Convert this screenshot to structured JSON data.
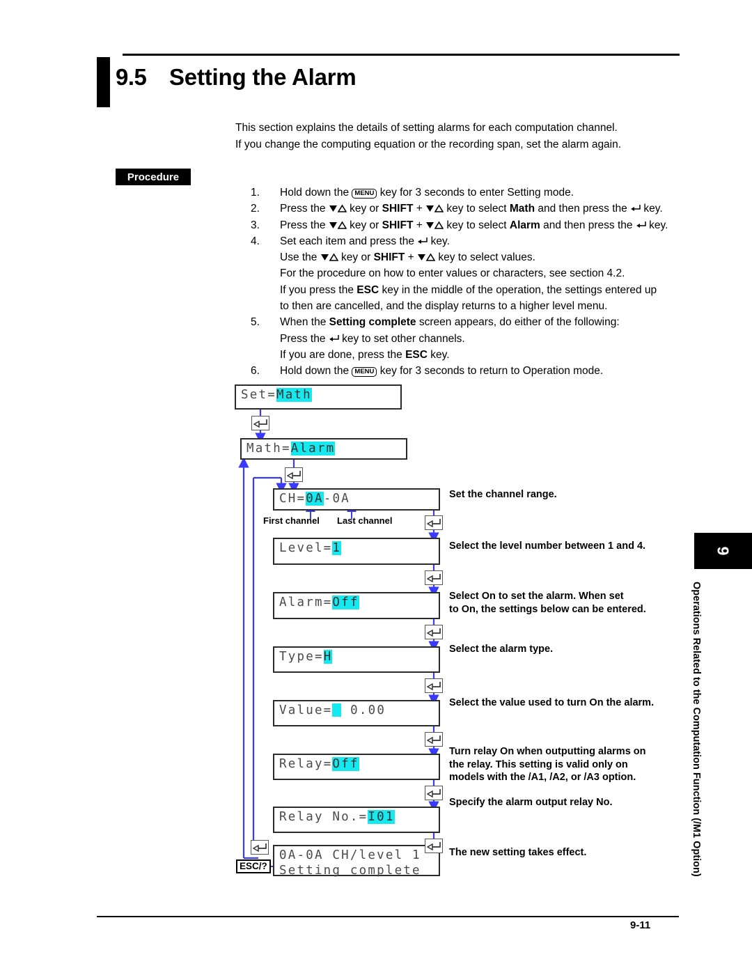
{
  "header": {
    "section_number": "9.5",
    "section_title": "Setting the Alarm"
  },
  "intro": {
    "line1": "This section explains the details of setting alarms for each computation channel.",
    "line2": "If you change the computing equation or the recording span, set the alarm again."
  },
  "procedure": {
    "badge": "Procedure",
    "steps": [
      {
        "num": "1.",
        "text": "Hold down the [MENU] key for 3 seconds to enter Setting mode."
      },
      {
        "num": "2.",
        "text": "Press the ▽△ key or SHIFT + ▽△ key to select Math and then press the ⏎ key."
      },
      {
        "num": "3.",
        "text": "Press the ▽△ key or SHIFT + ▽△ key to select Alarm and then press the ⏎ key."
      },
      {
        "num": "4.",
        "text": "Set each item and press the ⏎ key."
      },
      {
        "num": "",
        "text": "Use the ▽△ key or SHIFT + ▽△ key to select values."
      },
      {
        "num": "",
        "text": "For the procedure on how to enter values or characters, see section 4.2."
      },
      {
        "num": "",
        "text": "If you press the ESC key in the middle of the operation, the settings entered up"
      },
      {
        "num": "",
        "text": "to then are cancelled, and the display returns to a higher level menu."
      },
      {
        "num": "5.",
        "text": "When the Setting complete screen appears, do either of the following:"
      },
      {
        "num": "",
        "text": "Press the ⏎ key to set other channels."
      },
      {
        "num": "",
        "text": "If you are done, press the ESC key."
      },
      {
        "num": "6.",
        "text": "Hold down the [MENU] key for 3 seconds to return to Operation mode."
      }
    ],
    "step1_a": "Hold down the",
    "step1_b": "key for 3 seconds to enter Setting mode.",
    "step2_a": "Press the",
    "step2_b": "key or",
    "step2_shift": "SHIFT",
    "step2_c": "key to select",
    "step2_target": "Math",
    "step2_d": "and then press the",
    "step2_e": "key.",
    "step3_target": "Alarm",
    "step4_a": "Set each item and press the",
    "step4_b": "key.",
    "step4_use_a": "Use the",
    "step4_use_b": "key or",
    "step4_use_c": "key to select values.",
    "step4_sect": "For the procedure on how to enter values or characters, see section 4.2.",
    "step4_esc_a": "If you press the",
    "step4_esc_key": "ESC",
    "step4_esc_b": "key in the middle of the operation, the settings entered up",
    "step4_esc_c": "to then are cancelled, and the display returns to a higher level menu.",
    "step5_a": "When the",
    "step5_bold": "Setting complete",
    "step5_b": "screen appears, do either of the following:",
    "step5_press_a": "Press the",
    "step5_press_b": "key to set other channels.",
    "step5_done_a": "If you are done, press the",
    "step5_done_b": "key.",
    "step6_a": "Hold down the",
    "step6_b": "key for 3 seconds to return to Operation mode."
  },
  "flow": {
    "screens": [
      {
        "id": "set-math",
        "prefix": "Set=",
        "highlight": "Math",
        "suffix": ""
      },
      {
        "id": "math-alarm",
        "prefix": "Math=",
        "highlight": "Alarm",
        "suffix": ""
      },
      {
        "id": "ch-range",
        "prefix": "CH=",
        "highlight": "0A",
        "suffix": "-0A"
      },
      {
        "id": "level",
        "prefix": "Level=",
        "highlight": "1",
        "suffix": ""
      },
      {
        "id": "alarm-onoff",
        "prefix": "Alarm=",
        "highlight": "Off",
        "suffix": ""
      },
      {
        "id": "type",
        "prefix": "Type=",
        "highlight": "H",
        "suffix": ""
      },
      {
        "id": "value",
        "prefix": "Value=",
        "highlight": "",
        "suffix": "    0.00"
      },
      {
        "id": "relay-onoff",
        "prefix": "Relay=",
        "highlight": "Off",
        "suffix": ""
      },
      {
        "id": "relay-no",
        "prefix": "Relay No.=",
        "highlight": "I01",
        "suffix": ""
      }
    ],
    "complete_line1": "0A-0A CH/level 1",
    "complete_line2": "Setting complete",
    "first_channel_label": "First channel",
    "last_channel_label": "Last channel",
    "esc_label": "ESC/?",
    "annotations": {
      "ch_range": "Set the channel range.",
      "level": "Select the level number between 1 and 4.",
      "alarm_l1": "Select On to set the alarm.  When set",
      "alarm_l2": "to On, the settings below can be entered.",
      "type": "Select the alarm type.",
      "value": "Select the value used to turn On the alarm.",
      "relay_l1": "Turn relay On when outputting alarms on",
      "relay_l2": "the relay.  This setting is valid only on",
      "relay_l3": "models with the /A1, /A2, or /A3 option.",
      "relay_no": "Specify the alarm output relay No.",
      "complete": "The new setting takes effect."
    }
  },
  "sidetab": {
    "chapter": "9",
    "label": "Operations Related to the Computation Function (/M1 Option)"
  },
  "footer": {
    "page": "9-11"
  },
  "colors": {
    "highlight": "#15e9ef",
    "connector": "#3a3aff",
    "lcd_text": "#4a4a4a"
  }
}
